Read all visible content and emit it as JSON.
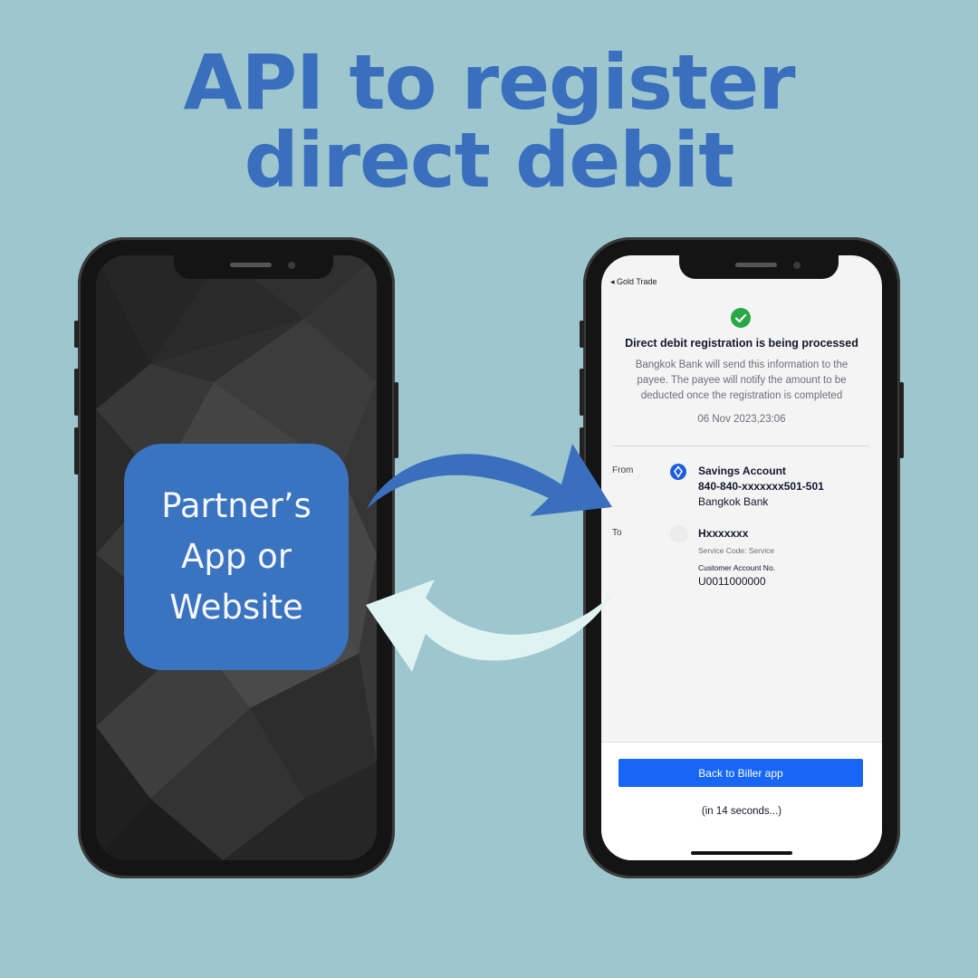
{
  "headline": {
    "line1": "API to register",
    "line2": "direct debit"
  },
  "partner_box": {
    "line1": "Partner’s",
    "line2": "App or",
    "line3": "Website"
  },
  "app": {
    "back_label": "◂ Gold Trade",
    "status_title": "Direct debit registration is being processed",
    "status_desc": "Bangkok Bank will send this information to the payee. The payee will notify the amount to be deducted once the registration is completed",
    "date": "06 Nov 2023,23:06",
    "from": {
      "label": "From",
      "account_type": "Savings Account",
      "account_number": "840-840-xxxxxxx501-501",
      "bank": "Bangkok Bank"
    },
    "to": {
      "label": "To",
      "payee": "Hxxxxxxx",
      "service_code": "Service Code: Service",
      "customer_account_label": "Customer Account No.",
      "customer_account": "U0011000000"
    },
    "button_label": "Back to Biller app",
    "countdown": "(in 14 seconds...)"
  },
  "colors": {
    "background": "#9dc6ce",
    "headline": "#3a6fbd",
    "partner_box": "#3a73bf",
    "forward_arrow": "#3a6fbd",
    "return_arrow": "#e0f3f3",
    "button": "#1766f5",
    "success": "#28a745"
  },
  "icons": [
    "check-circle-icon",
    "bank-logo-icon",
    "payee-avatar-icon",
    "back-caret-icon"
  ]
}
